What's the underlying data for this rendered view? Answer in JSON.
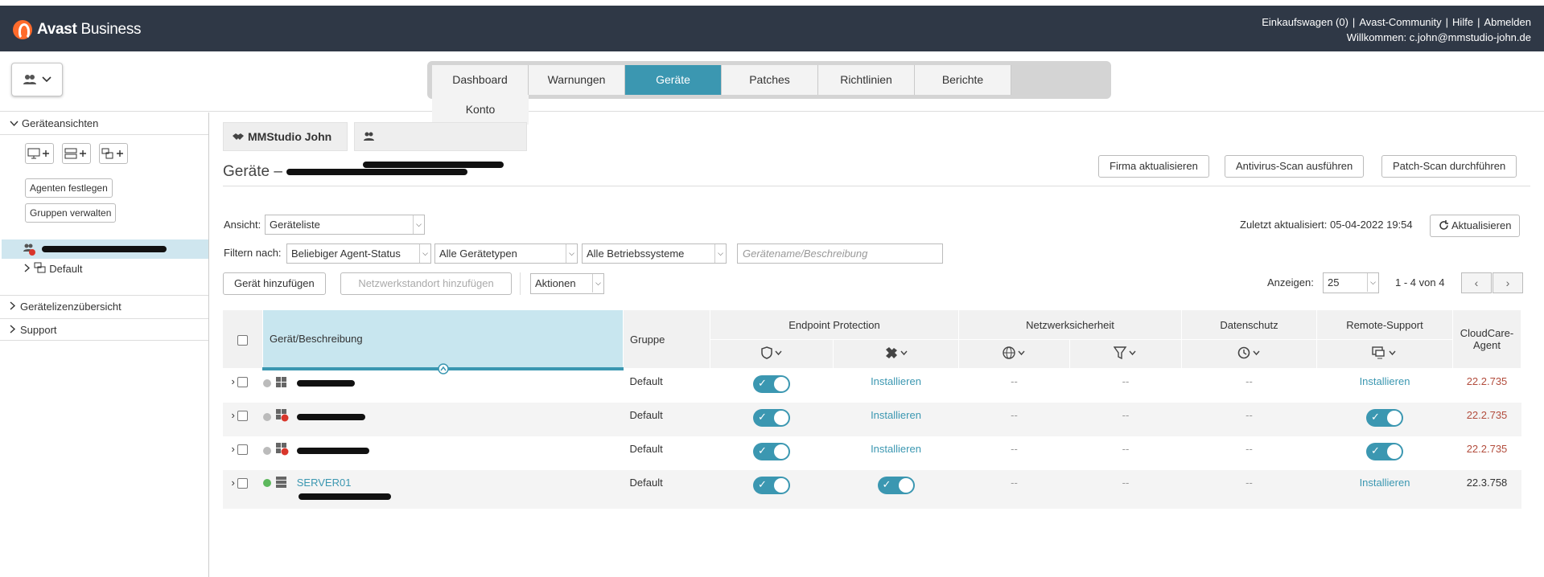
{
  "brand": {
    "name_bold": "Avast",
    "name_rest": " Business"
  },
  "toplinks": {
    "cart": "Einkaufswagen (0)",
    "community": "Avast-Community",
    "help": "Hilfe",
    "logout": "Abmelden",
    "welcome": "Willkommen: c.john@mmstudio-john.de"
  },
  "tabs": [
    {
      "label": "Dashboard"
    },
    {
      "label": "Warnungen"
    },
    {
      "label": "Geräte",
      "active": true
    },
    {
      "label": "Patches"
    },
    {
      "label": "Richtlinien"
    },
    {
      "label": "Berichte"
    },
    {
      "label": "Konto"
    }
  ],
  "sidebar": {
    "views_title": "Geräteansichten",
    "set_agents": "Agenten festlegen",
    "manage_groups": "Gruppen verwalten",
    "tree_default": "Default",
    "licenses": "Gerätelizenzübersicht",
    "support": "Support"
  },
  "crumbs": {
    "company": "MMStudio John"
  },
  "page": {
    "title": "Geräte –"
  },
  "actions": {
    "update_company": "Firma aktualisieren",
    "av_scan": "Antivirus-Scan ausführen",
    "patch_scan": "Patch-Scan durchführen"
  },
  "view": {
    "label": "Ansicht:",
    "value": "Geräteliste"
  },
  "last_updated": "Zuletzt aktualisiert: 05-04-2022 19:54",
  "refresh": "Aktualisieren",
  "filters": {
    "label": "Filtern nach:",
    "agent_status": "Beliebiger Agent-Status",
    "device_types": "Alle Gerätetypen",
    "os": "Alle Betriebssysteme",
    "search_placeholder": "Gerätename/Beschreibung"
  },
  "toolbar": {
    "add_device": "Gerät hinzufügen",
    "add_network": "Netzwerkstandort hinzufügen",
    "actions": "Aktionen"
  },
  "paging": {
    "show_label": "Anzeigen:",
    "per_page": "25",
    "range": "1 - 4 von 4"
  },
  "table": {
    "col_device": "Gerät/Beschreibung",
    "col_group": "Gruppe",
    "grp_endpoint": "Endpoint Protection",
    "grp_network": "Netzwerksicherheit",
    "grp_privacy": "Datenschutz",
    "grp_remote": "Remote-Support",
    "col_cloudcare": "CloudCare-Agent",
    "rows": [
      {
        "name": "",
        "group": "Default",
        "ep1": "toggle",
        "ep2": "Installieren",
        "net1": "--",
        "net2": "--",
        "priv": "--",
        "remote": "Installieren",
        "agent": "22.2.735",
        "agent_red": true,
        "status": "grey"
      },
      {
        "name": "",
        "group": "Default",
        "ep1": "toggle",
        "ep2": "Installieren",
        "net1": "--",
        "net2": "--",
        "priv": "--",
        "remote": "toggle",
        "agent": "22.2.735",
        "agent_red": true,
        "status": "grey"
      },
      {
        "name": "",
        "group": "Default",
        "ep1": "toggle",
        "ep2": "Installieren",
        "net1": "--",
        "net2": "--",
        "priv": "--",
        "remote": "toggle",
        "agent": "22.2.735",
        "agent_red": true,
        "status": "grey"
      },
      {
        "name": "SERVER01",
        "group": "Default",
        "ep1": "toggle",
        "ep2": "toggle",
        "net1": "--",
        "net2": "--",
        "priv": "--",
        "remote": "Installieren",
        "agent": "22.3.758",
        "agent_red": false,
        "status": "green"
      }
    ]
  },
  "colors": {
    "topbar": "#2f3846",
    "accent": "#3b97b1",
    "outdated": "#b24c3c",
    "online": "#5cb85c"
  }
}
